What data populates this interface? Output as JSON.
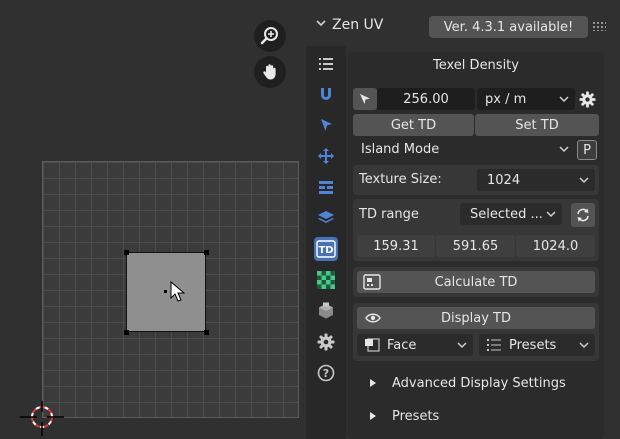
{
  "viewport": {
    "zoom_icon": "zoom-magnifier-icon",
    "pan_icon": "hand-pan-icon",
    "cursor_icon": "2d-cursor-icon",
    "pointer_icon": "mouse-pointer-icon"
  },
  "header": {
    "title": "Zen UV",
    "version_label": "Ver. 4.3.1 available!"
  },
  "tabs": [
    {
      "name": "list-icon"
    },
    {
      "name": "magnet-icon"
    },
    {
      "name": "select-arrow-icon"
    },
    {
      "name": "move-icon"
    },
    {
      "name": "stack-icon"
    },
    {
      "name": "layers-icon"
    },
    {
      "name": "td-icon",
      "label": "TD",
      "active": true
    },
    {
      "name": "checker-icon"
    },
    {
      "name": "package-icon"
    },
    {
      "name": "gear-icon"
    },
    {
      "name": "help-icon",
      "label": "?"
    }
  ],
  "texel_density": {
    "title": "Texel Density",
    "td_value": "256.00",
    "unit": "px / m",
    "get_td": "Get TD",
    "set_td": "Set TD",
    "mode": "Island Mode",
    "p_toggle": "P",
    "texture_size_label": "Texture Size:",
    "texture_size_value": "1024",
    "td_range_label": "TD range",
    "td_range_value": "Selected ...",
    "range_values": [
      "159.31",
      "591.65",
      "1024.0"
    ],
    "calculate_td": "Calculate TD",
    "display_td": "Display TD",
    "display_mode": "Face",
    "presets_dropdown": "Presets",
    "advanced_display": "Advanced Display Settings",
    "presets_panel": "Presets"
  },
  "colors": {
    "accent": "#4772b3",
    "background": "#303030",
    "button": "#545454"
  }
}
